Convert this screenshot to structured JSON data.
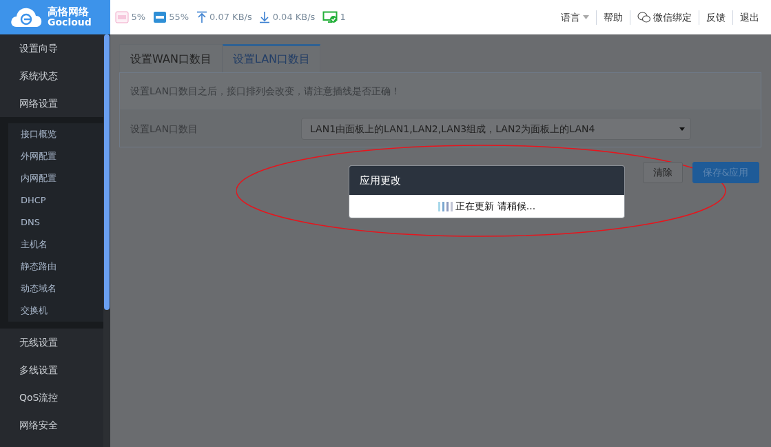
{
  "header": {
    "logo": {
      "name": "高恪网络",
      "sub": "Gocloud"
    },
    "stats": [
      {
        "kind": "cpu",
        "value": "5%"
      },
      {
        "kind": "ram",
        "value": "55%"
      },
      {
        "kind": "upload",
        "value": "0.07 KB/s"
      },
      {
        "kind": "download",
        "value": "0.04 KB/s"
      },
      {
        "kind": "devices",
        "value": "1"
      }
    ],
    "menu": [
      {
        "kind": "dropdown",
        "label": "语言"
      },
      {
        "kind": "link",
        "label": "帮助"
      },
      {
        "kind": "wechat",
        "label": "微信绑定"
      },
      {
        "kind": "link",
        "label": "反馈"
      },
      {
        "kind": "link",
        "label": "退出"
      }
    ]
  },
  "sidebar": {
    "items": [
      {
        "label": "设置向导"
      },
      {
        "label": "系统状态"
      },
      {
        "label": "网络设置",
        "expanded": true,
        "children": [
          {
            "label": "接口概览"
          },
          {
            "label": "外网配置"
          },
          {
            "label": "内网配置"
          },
          {
            "label": "DHCP"
          },
          {
            "label": "DNS"
          },
          {
            "label": "主机名"
          },
          {
            "label": "静态路由"
          },
          {
            "label": "动态域名"
          },
          {
            "label": "交换机"
          }
        ]
      },
      {
        "label": "无线设置"
      },
      {
        "label": "多线设置"
      },
      {
        "label": "QoS流控"
      },
      {
        "label": "网络安全"
      }
    ]
  },
  "tabs": [
    {
      "label": "设置WAN口数目",
      "selected": false
    },
    {
      "label": "设置LAN口数目",
      "selected": true
    }
  ],
  "notice": "设置LAN口数目之后，接口排列会改变，请注意插线是否正确！",
  "form": {
    "label": "设置LAN口数目",
    "value": "LAN1由面板上的LAN1,LAN2,LAN3组成，LAN2为面板上的LAN4"
  },
  "buttons": [
    {
      "kind": "secondary",
      "label": "清除"
    },
    {
      "kind": "primary",
      "label": "保存&应用"
    }
  ],
  "modal": {
    "title": "应用更改",
    "message": "正在更新 请稍候..."
  }
}
